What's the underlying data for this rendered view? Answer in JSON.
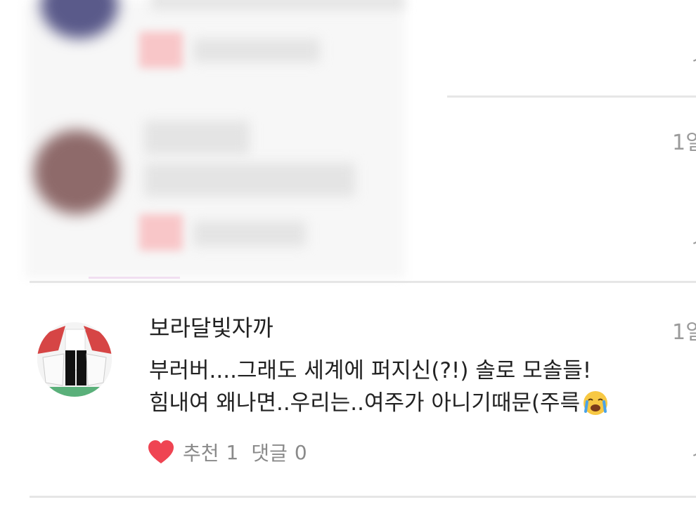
{
  "colors": {
    "heart": "#ef4452",
    "text_primary": "#222222",
    "text_secondary": "#8a8a8a",
    "divider": "#e6e6e6"
  },
  "comment": {
    "author": "보라달빛자까",
    "content_lines": [
      "부러버....그래도 세계에 퍼지신(?!) 솔로 모솔들!",
      "힘내여 왜나면..우리는..여주가 아니기때문(주륵"
    ],
    "emoji": "😭",
    "date_fragment": "1일",
    "like_label": "추천",
    "like_count": "1",
    "reply_label": "댓글",
    "reply_count": "0"
  },
  "previous_items": [
    {
      "date_fragment": ""
    },
    {
      "date_fragment": "1일"
    }
  ],
  "icons": [
    "heart-icon",
    "more-icon",
    "crying-emoji-icon",
    "avatar"
  ]
}
